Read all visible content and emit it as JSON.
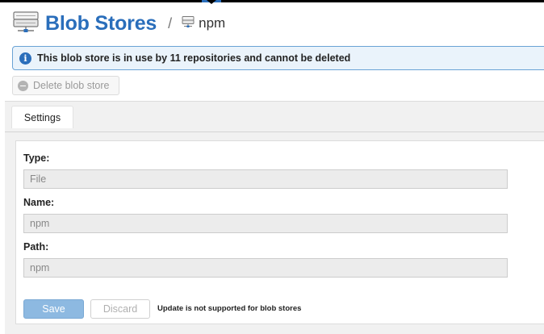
{
  "header": {
    "title": "Blob Stores",
    "separator": "/",
    "breadcrumb": "npm"
  },
  "info_banner": {
    "icon": "info-icon",
    "text": "This blob store is in use by 11 repositories and cannot be deleted"
  },
  "toolbar": {
    "delete_label": "Delete blob store",
    "delete_icon": "minus-circle-icon"
  },
  "tabs": [
    {
      "label": "Settings",
      "active": true
    }
  ],
  "form": {
    "fields": [
      {
        "label": "Type:",
        "value": "File"
      },
      {
        "label": "Name:",
        "value": "npm"
      },
      {
        "label": "Path:",
        "value": "npm"
      }
    ],
    "save_label": "Save",
    "discard_label": "Discard",
    "note": "Update is not supported for blob stores"
  },
  "colors": {
    "accent": "#2a6ebb",
    "info_background": "#eaf3fb",
    "save_button": "#8db9e1"
  }
}
